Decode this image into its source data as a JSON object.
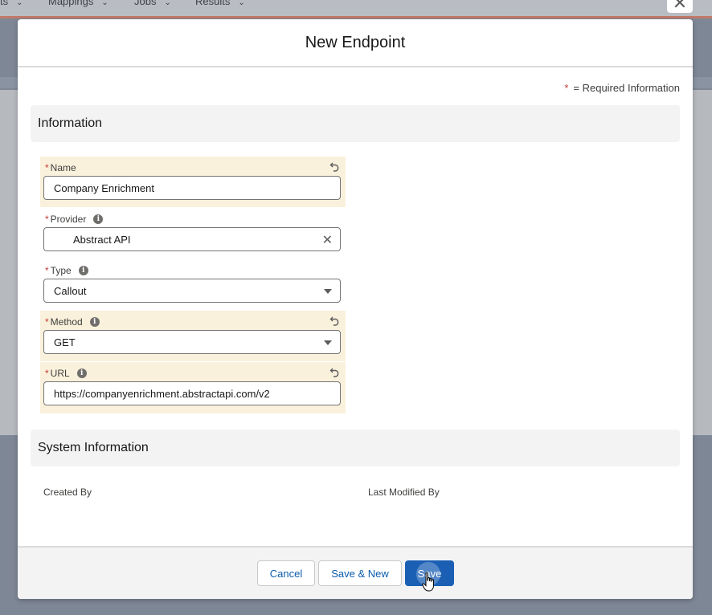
{
  "background": {
    "nav_tabs": [
      {
        "label": "ts"
      },
      {
        "label": "Mappings"
      },
      {
        "label": "Jobs"
      },
      {
        "label": "Results"
      }
    ]
  },
  "modal": {
    "title": "New Endpoint",
    "required_info": "= Required Information",
    "required_star": "*",
    "sections": {
      "information": "Information",
      "system_information": "System Information"
    },
    "fields": {
      "name": {
        "label": "Name",
        "value": "Company Enrichment"
      },
      "provider": {
        "label": "Provider",
        "value": "Abstract API"
      },
      "type": {
        "label": "Type",
        "value": "Callout"
      },
      "method": {
        "label": "Method",
        "value": "GET"
      },
      "url": {
        "label": "URL",
        "value": "https://companyenrichment.abstractapi.com/v2"
      }
    },
    "system": {
      "created_by": "Created By",
      "last_modified_by": "Last Modified By"
    },
    "footer": {
      "cancel": "Cancel",
      "save_new": "Save & New",
      "save": "Save"
    }
  },
  "colors": {
    "brand": "#1b5fb5",
    "highlight": "#faf1dc",
    "required": "#c23934"
  }
}
